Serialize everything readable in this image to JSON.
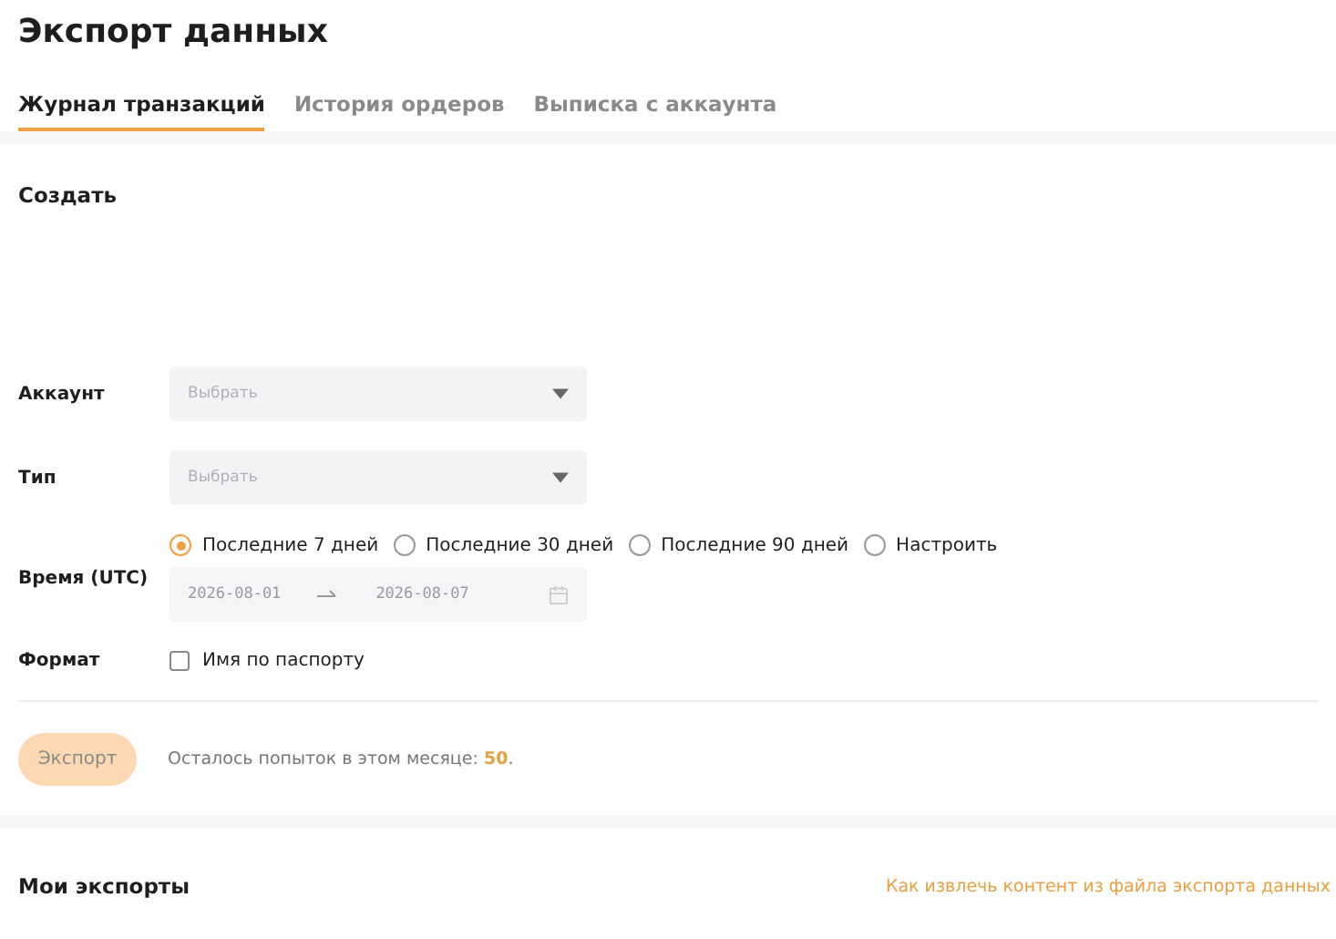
{
  "title": "Экспорт данных",
  "tabs": [
    {
      "label": "Журнал транзакций",
      "selected": true
    },
    {
      "label": "История ордеров",
      "selected": false
    },
    {
      "label": "Выписка с аккаунта",
      "selected": false
    }
  ],
  "create": {
    "heading": "Создать",
    "account": {
      "label": "Аккаунт",
      "placeholder": "Выбрать"
    },
    "type": {
      "label": "Тип",
      "placeholder": "Выбрать"
    },
    "time": {
      "label": "Время (UTC)",
      "options": [
        {
          "label": "Последние 7 дней",
          "selected": true
        },
        {
          "label": "Последние 30 дней",
          "selected": false
        },
        {
          "label": "Последние 90 дней",
          "selected": false
        },
        {
          "label": "Настроить",
          "selected": false
        }
      ],
      "range": {
        "start": "2026-08-01",
        "end": "2026-08-07",
        "disabled": true
      }
    },
    "format": {
      "label": "Формат",
      "option": {
        "label": "Имя по паспорту",
        "checked": false
      }
    },
    "export_button": {
      "label": "Экспорт",
      "disabled": true
    },
    "attempts": {
      "prefix": "Осталось попыток в этом месяце: ",
      "count": "50",
      "suffix": "."
    }
  },
  "my_exports": {
    "heading": "Мои экспорты",
    "help_link": "Как извлечь контент из файла экспорта данных"
  }
}
